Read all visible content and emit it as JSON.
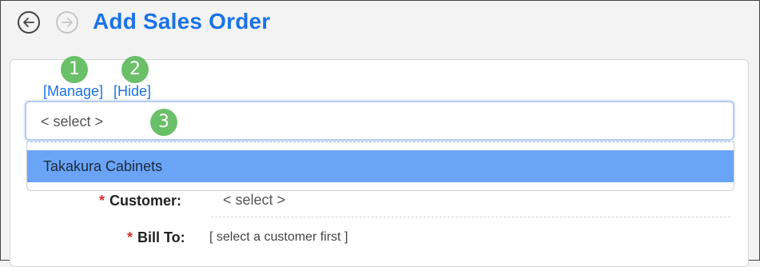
{
  "header": {
    "title": "Add Sales Order",
    "back_icon": "arrow-left-circle-icon",
    "forward_icon": "arrow-right-circle-icon"
  },
  "customer_picker": {
    "manage_link": "[Manage]",
    "hide_link": "[Hide]",
    "select_value": "< select >",
    "options": [
      "Takakura Cabinets"
    ]
  },
  "badges": [
    "1",
    "2",
    "3"
  ],
  "form": {
    "customer": {
      "required_marker": "*",
      "label": "Customer:",
      "value": "< select >"
    },
    "bill_to": {
      "required_marker": "*",
      "label": "Bill To:",
      "value": "[ select a customer first ]"
    }
  },
  "colors": {
    "accent": "#1a73e8",
    "badge": "#6abf69",
    "highlight": "#6aa4f7",
    "required": "#d32f2f"
  }
}
